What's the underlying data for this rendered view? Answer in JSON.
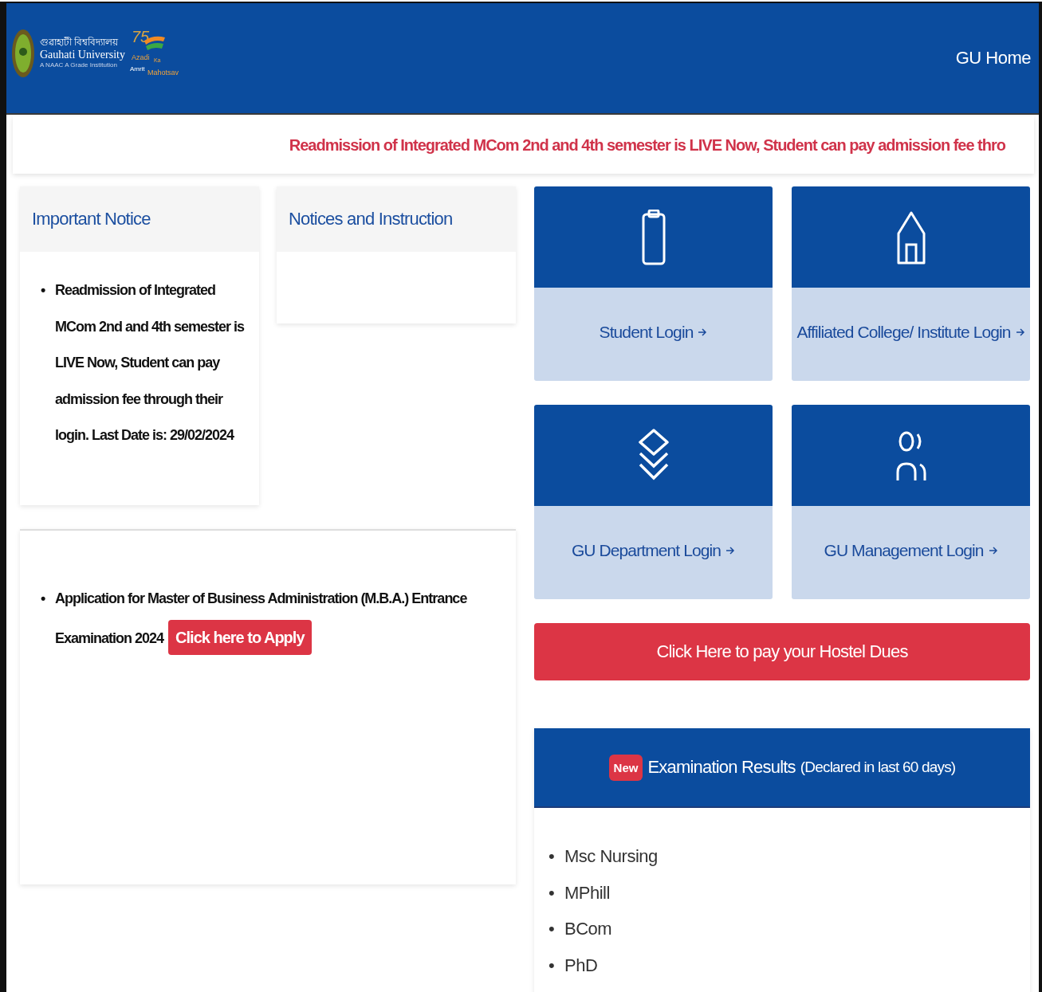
{
  "header": {
    "logo": {
      "title_bengali": "গুৱাহাটী বিশ্ববিদ্যালয়",
      "title": "Gauhati University",
      "subtitle": "A NAAC A Grade Institution",
      "jubilee_number": "75",
      "jubilee_top": "Azadi",
      "jubilee_ka": "Ka",
      "jubilee_amrit": "Amrit",
      "jubilee_bottom": "Mahotsav"
    },
    "nav_link": "GU Home"
  },
  "ticker": "Readmission of Integrated MCom 2nd and 4th semester is LIVE Now, Student can pay admission fee thro",
  "important_notice": {
    "title": "Important Notice",
    "marker": "•",
    "items": [
      "Readmission of Integrated MCom 2nd and 4th semester is LIVE Now, Student can pay admission fee through their login. Last Date is: 29/02/2024"
    ]
  },
  "notices_instruction": {
    "title": "Notices and Instruction"
  },
  "announcement": {
    "marker": "•",
    "items": [
      {
        "text": "Application for Master of Business Administration (M.B.A.) Entrance Examination 2024",
        "button": "Click here to Apply"
      }
    ]
  },
  "login_tiles": [
    {
      "kind": "phone",
      "label": "Student Login"
    },
    {
      "kind": "house",
      "label": "Affiliated College/ Institute Login"
    },
    {
      "kind": "layers",
      "label": "GU Department Login"
    },
    {
      "kind": "users",
      "label": "GU Management Login"
    }
  ],
  "hostel_button": "Click Here to pay your Hostel Dues",
  "results": {
    "badge": "New",
    "title": "Examination Results",
    "note": "(Declared in last 60 days)",
    "marker": "•",
    "items": [
      "Msc Nursing",
      "MPhill",
      "BCom",
      "PhD"
    ]
  }
}
